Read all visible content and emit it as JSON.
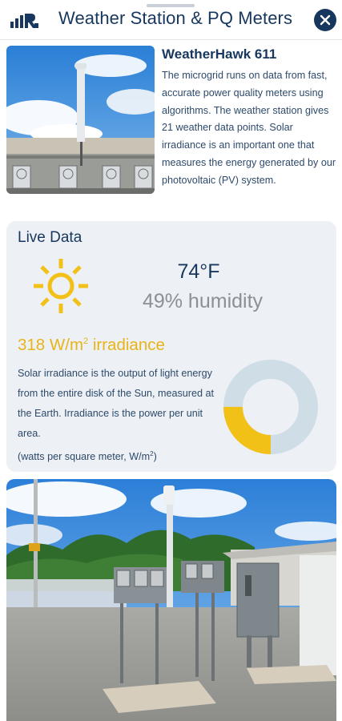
{
  "header": {
    "title": "Weather Station & PQ Meters",
    "logo_icon": "bar-chart-logo-icon",
    "close_icon": "close-icon"
  },
  "station": {
    "name": "WeatherHawk 611",
    "description": "The microgrid runs on data from fast, accurate power quality meters using algorithms. The weather station gives 21 weather data points. Solar irradiance is an important one that measures the energy generated by our photovoltaic (PV) system."
  },
  "live_data": {
    "title": "Live Data",
    "weather_icon": "sun-icon",
    "temperature": "74°F",
    "humidity": "49% humidity",
    "irradiance_value": "318 W/m",
    "irradiance_exp": "2",
    "irradiance_suffix": " irradiance",
    "irradiance_fraction": 0.25,
    "description": "Solar irradiance is the output of light energy from the entire disk of the Sun, measured at the Earth. Irradiance is the power per unit area.",
    "units_note": "(watts per square meter, W/m",
    "units_exp": "2",
    "units_close": ")"
  },
  "colors": {
    "brand": "#17375e",
    "accent": "#f2c118",
    "card_bg": "#edf0f4",
    "donut_track": "#cfdde6"
  }
}
